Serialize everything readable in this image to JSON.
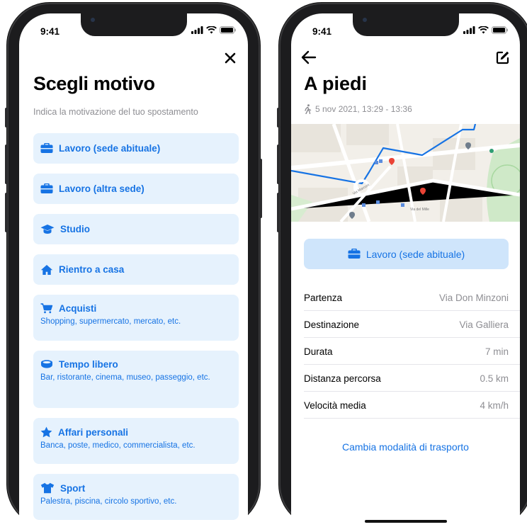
{
  "status": {
    "time": "9:41"
  },
  "left": {
    "title": "Scegli motivo",
    "subtitle": "Indica la motivazione del tuo spostamento",
    "options": [
      {
        "label": "Lavoro (sede abituale)",
        "desc": "",
        "icon": "briefcase-icon"
      },
      {
        "label": "Lavoro (altra sede)",
        "desc": "",
        "icon": "briefcase-icon"
      },
      {
        "label": "Studio",
        "desc": "",
        "icon": "graduation-cap-icon"
      },
      {
        "label": "Rientro a casa",
        "desc": "",
        "icon": "home-icon"
      },
      {
        "label": "Acquisti",
        "desc": "Shopping, supermercato, mercato, etc.",
        "icon": "cart-icon"
      },
      {
        "label": "Tempo libero",
        "desc": "Bar, ristorante, cinema, museo, passeggio, etc.",
        "icon": "cup-icon"
      },
      {
        "label": "Affari personali",
        "desc": "Banca, poste, medico, commercialista, etc.",
        "icon": "star-icon"
      },
      {
        "label": "Sport",
        "desc": "Palestra, piscina, circolo sportivo, etc.",
        "icon": "shirt-icon"
      }
    ]
  },
  "right": {
    "title": "A piedi",
    "subtitle": "5 nov 2021, 13:29 - 13:36",
    "map_labels": [
      "Via del Mille",
      "Via Marconi"
    ],
    "reason": "Lavoro (sede abituale)",
    "rows": [
      {
        "key": "Partenza",
        "value": "Via Don Minzoni"
      },
      {
        "key": "Destinazione",
        "value": "Via Galliera"
      },
      {
        "key": "Durata",
        "value": "7 min"
      },
      {
        "key": "Distanza percorsa",
        "value": "0.5 km"
      },
      {
        "key": "Velocità media",
        "value": "4 km/h"
      }
    ],
    "change_link": "Cambia modalità di trasporto"
  },
  "colors": {
    "accent": "#1673e4",
    "option_bg": "#e6f2fd",
    "reason_bg": "#cfe5fb"
  }
}
